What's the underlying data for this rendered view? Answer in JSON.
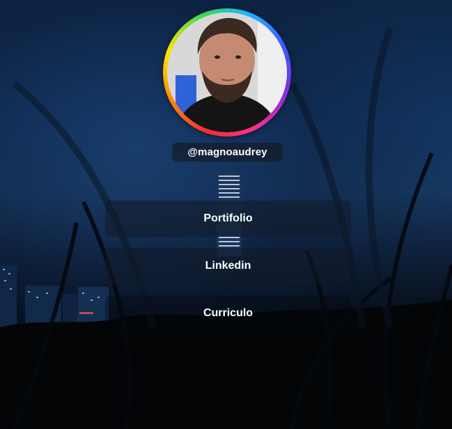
{
  "profile": {
    "avatar_icon": "profile-photo",
    "username": "@magnoaudrey",
    "ring_colors": [
      "#ff2d2d",
      "#ff8a00",
      "#ffe600",
      "#3ddc4a",
      "#1fb4ff",
      "#3a5bff",
      "#8a2be2"
    ]
  },
  "links": [
    {
      "label": "Portifolio"
    },
    {
      "label": "Linkedin"
    },
    {
      "label": "Curriculo"
    }
  ]
}
